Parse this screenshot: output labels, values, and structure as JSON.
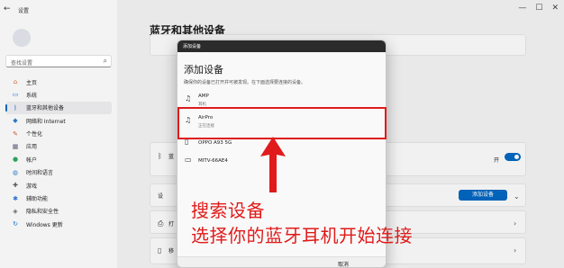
{
  "window": {
    "app_title": "设置",
    "back_icon": "back-arrow-icon",
    "controls": [
      "—",
      "☐",
      "✕"
    ]
  },
  "search": {
    "placeholder": "查找设置"
  },
  "nav": {
    "items": [
      {
        "label": "主页",
        "icon": "home-icon",
        "glyph": "⌂",
        "color": "#d06a2b"
      },
      {
        "label": "系统",
        "icon": "monitor-icon",
        "glyph": "▭",
        "color": "#2b6fd0"
      },
      {
        "label": "蓝牙和其他设备",
        "icon": "bluetooth-icon",
        "glyph": "ᛒ",
        "color": "#1a6fd0",
        "active": true
      },
      {
        "label": "网络和 Internet",
        "icon": "wifi-icon",
        "glyph": "◆",
        "color": "#2b78c2"
      },
      {
        "label": "个性化",
        "icon": "brush-icon",
        "glyph": "✎",
        "color": "#c7582b"
      },
      {
        "label": "应用",
        "icon": "apps-icon",
        "glyph": "▦",
        "color": "#5a5a7a"
      },
      {
        "label": "帐户",
        "icon": "account-icon",
        "glyph": "●",
        "color": "#2ba35a"
      },
      {
        "label": "时间和语言",
        "icon": "globe-icon",
        "glyph": "◍",
        "color": "#2b7ad0"
      },
      {
        "label": "游戏",
        "icon": "gamepad-icon",
        "glyph": "✚",
        "color": "#555"
      },
      {
        "label": "辅助功能",
        "icon": "accessibility-icon",
        "glyph": "✱",
        "color": "#2b6fd0"
      },
      {
        "label": "隐私和安全性",
        "icon": "shield-icon",
        "glyph": "◈",
        "color": "#666"
      },
      {
        "label": "Windows 更新",
        "icon": "update-icon",
        "glyph": "↻",
        "color": "#1a6fd0"
      }
    ]
  },
  "main": {
    "heading": "蓝牙和其他设备",
    "toggle_state": "开",
    "add_device_button": "添加设备",
    "row_labels": {
      "bluetooth": "蓝",
      "devices": "设",
      "printers": "打",
      "phone": "移"
    }
  },
  "dialog": {
    "header": "添加设备",
    "title": "添加设备",
    "subtitle": "确保你的设备已打开并可被发现。在下面选择要连接的设备。",
    "devices": [
      {
        "name": "AMP",
        "status": "耳机",
        "icon": "headphones-icon"
      },
      {
        "name": "AirPro",
        "status": "正在连接",
        "icon": "headphones-icon"
      },
      {
        "name": "OPPO A93 5G",
        "status": "",
        "icon": "phone-icon"
      },
      {
        "name": "MITV-66AE4",
        "status": "",
        "icon": "tv-icon"
      }
    ],
    "cancel": "取消"
  },
  "annotation": {
    "line1": "搜索设备",
    "line2": "选择你的蓝牙耳机开始连接",
    "color": "#e01b1b"
  }
}
